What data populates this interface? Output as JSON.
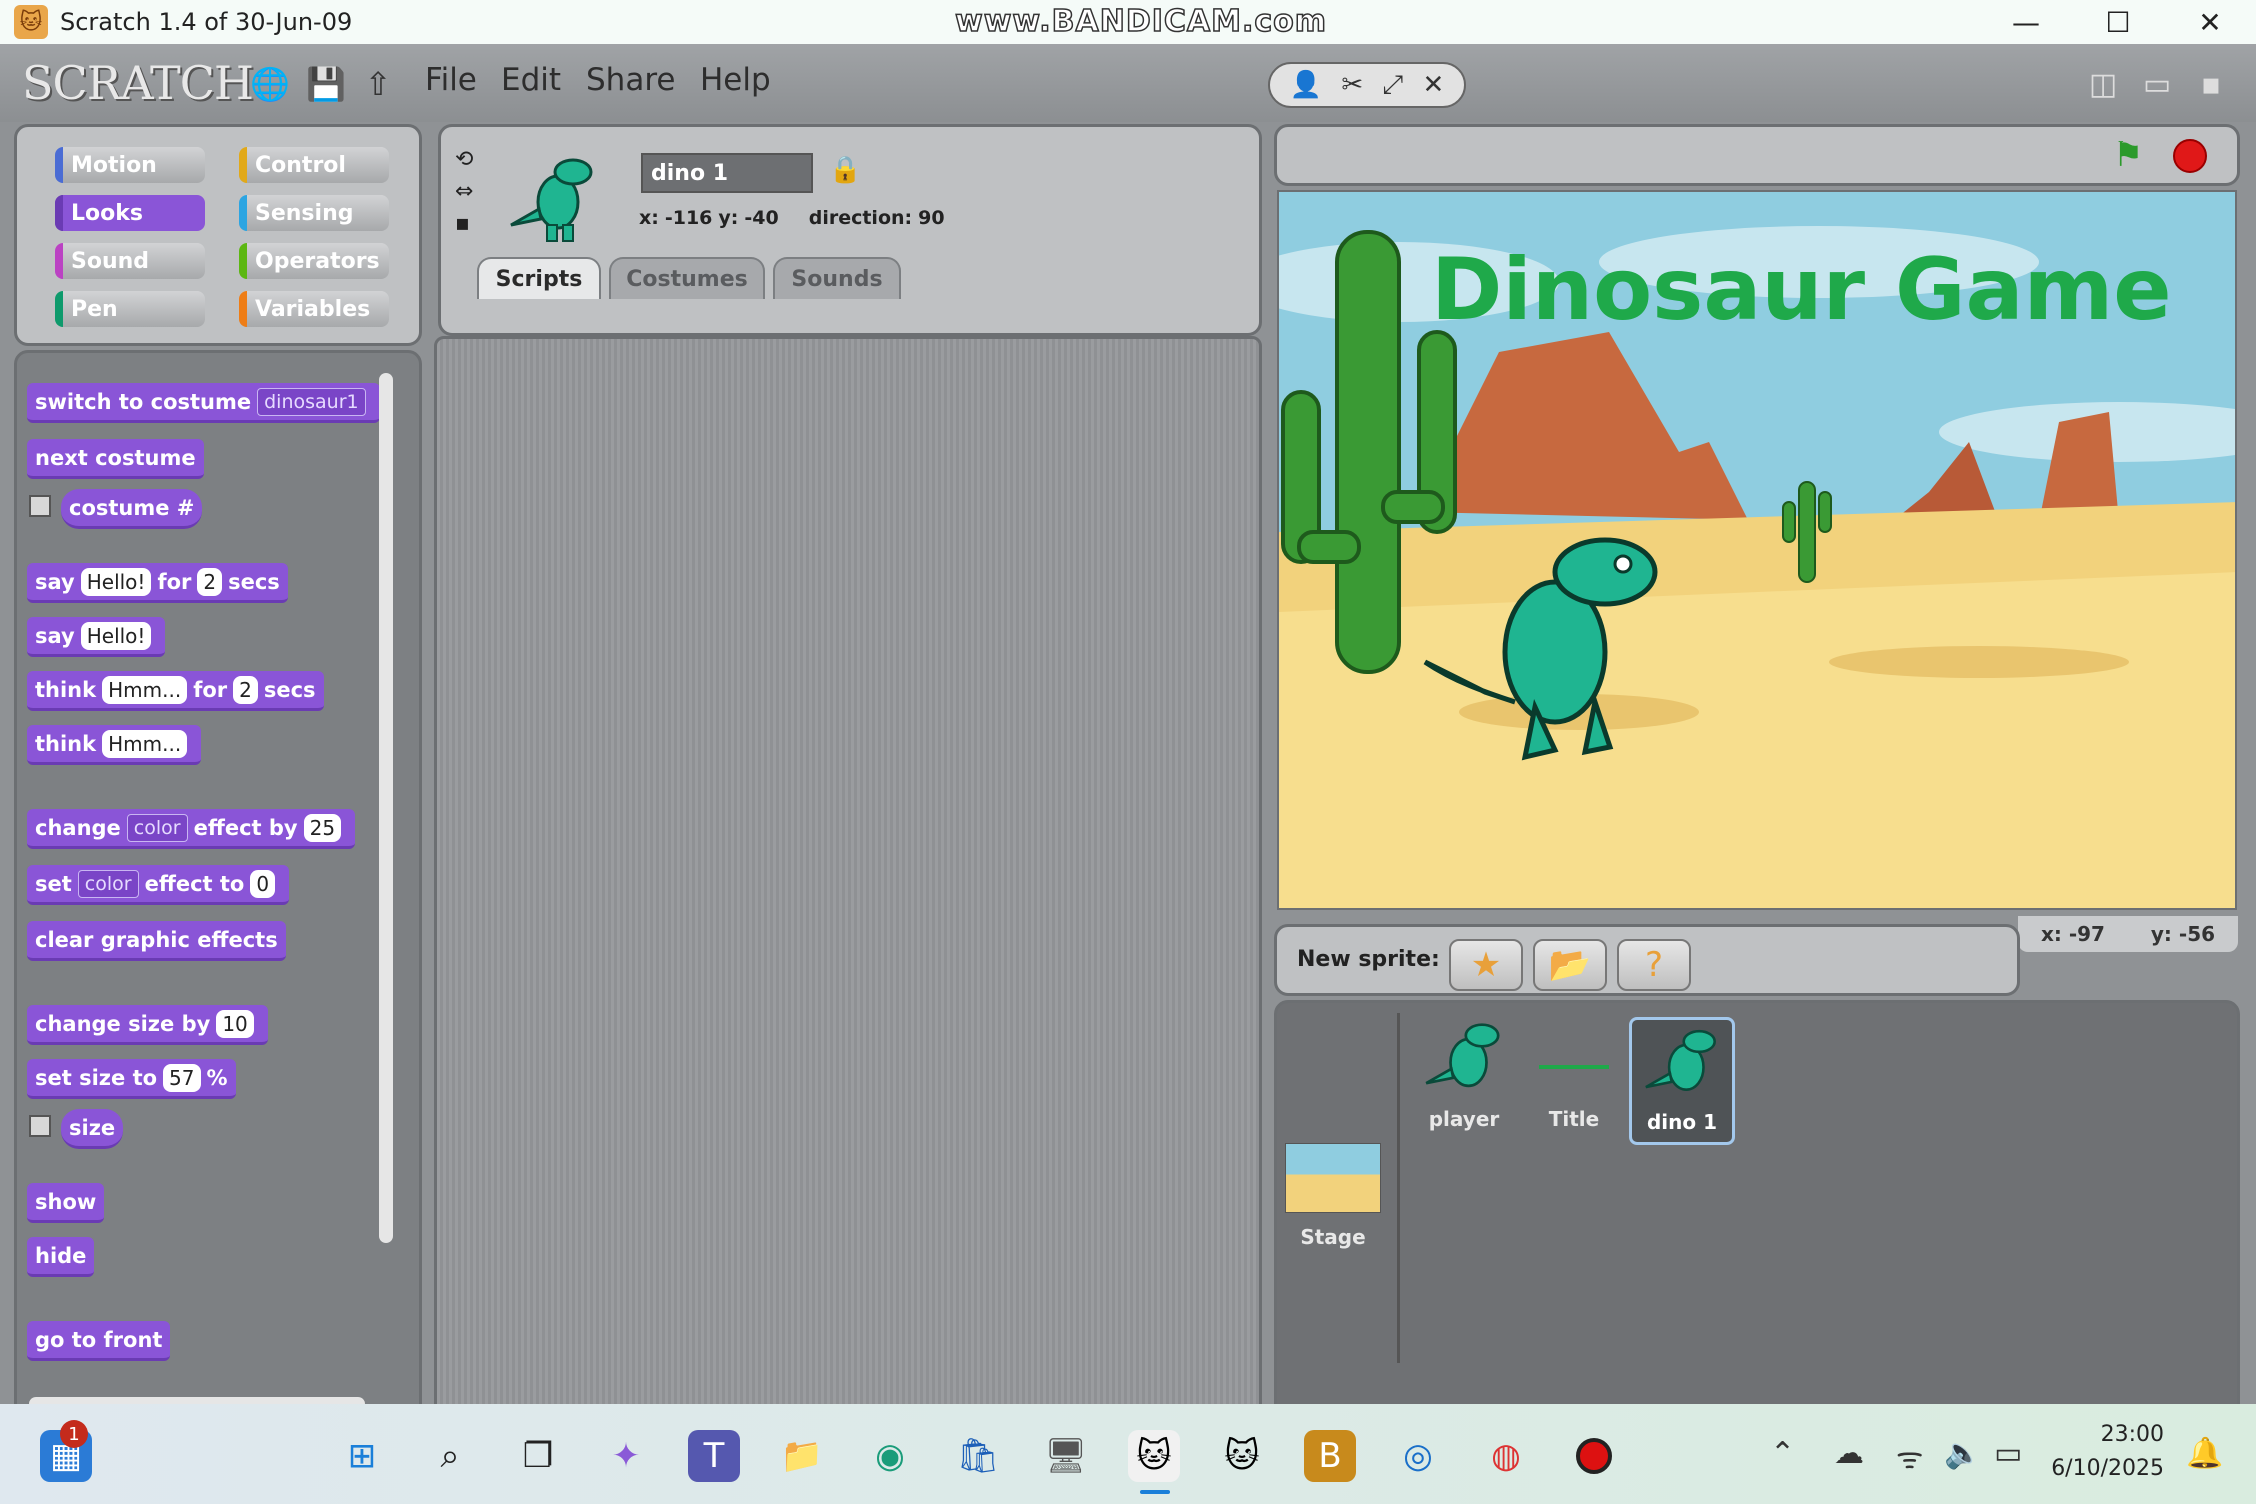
{
  "window": {
    "title": "Scratch 1.4 of 30-Jun-09",
    "watermark": "www.BANDICAM.com",
    "controls": [
      "minimize-icon",
      "maximize-icon",
      "close-icon"
    ]
  },
  "menubar": {
    "logo": "SCRATCH",
    "menus": [
      "File",
      "Edit",
      "Share",
      "Help"
    ],
    "icons": [
      "globe-icon",
      "save-icon",
      "share-upload-icon"
    ],
    "tools": [
      "duplicate-icon",
      "delete-icon",
      "grow-icon",
      "shrink-icon"
    ],
    "view_modes": [
      "small-stage-icon",
      "normal-stage-icon",
      "presentation-icon"
    ]
  },
  "categories": [
    {
      "label": "Motion",
      "color": "#4a6cd4"
    },
    {
      "label": "Control",
      "color": "#e1a91a"
    },
    {
      "label": "Looks",
      "color": "#8a55d7",
      "active": true
    },
    {
      "label": "Sensing",
      "color": "#2ca5e2"
    },
    {
      "label": "Sound",
      "color": "#bb42c3"
    },
    {
      "label": "Operators",
      "color": "#5cb712"
    },
    {
      "label": "Pen",
      "color": "#0e9a6c"
    },
    {
      "label": "Variables",
      "color": "#ee7d16"
    }
  ],
  "blocks": {
    "switch_costume": {
      "label": "switch to costume",
      "value": "dinosaur1"
    },
    "next_costume": "next costume",
    "costume_num": "costume #",
    "say_for": {
      "a": "say",
      "text": "Hello!",
      "b": "for",
      "secs": "2",
      "c": "secs"
    },
    "say": {
      "a": "say",
      "text": "Hello!"
    },
    "think_for": {
      "a": "think",
      "text": "Hmm...",
      "b": "for",
      "secs": "2",
      "c": "secs"
    },
    "think": {
      "a": "think",
      "text": "Hmm..."
    },
    "change_effect": {
      "a": "change",
      "effect": "color",
      "b": "effect by",
      "value": "25"
    },
    "set_effect": {
      "a": "set",
      "effect": "color",
      "b": "effect to",
      "value": "0"
    },
    "clear_effects": "clear graphic effects",
    "change_size": {
      "a": "change size by",
      "value": "10"
    },
    "set_size": {
      "a": "set size to",
      "value": "57",
      "b": "%"
    },
    "size": "size",
    "show": "show",
    "hide": "hide",
    "go_front": "go to front"
  },
  "sprite": {
    "name": "dino 1",
    "x_label": "x:",
    "x": "-116",
    "y_label": "y:",
    "y": "-40",
    "direction_label": "direction:",
    "direction": "90",
    "rotation_icons": [
      "rotate-icon",
      "flip-icon",
      "no-rotate-icon"
    ]
  },
  "tabs": [
    {
      "label": "Scripts",
      "active": true
    },
    {
      "label": "Costumes"
    },
    {
      "label": "Sounds"
    }
  ],
  "stage": {
    "title_text": "Dinosaur Game",
    "mouse_x_label": "x:",
    "mouse_x": "-97",
    "mouse_y_label": "y:",
    "mouse_y": "-56"
  },
  "new_sprite": {
    "label": "New sprite:",
    "buttons": [
      "paint-sprite-icon",
      "choose-sprite-icon",
      "random-sprite-icon"
    ]
  },
  "sprite_list": [
    {
      "name": "player"
    },
    {
      "name": "Title"
    },
    {
      "name": "dino 1",
      "selected": true
    }
  ],
  "stage_thumb": {
    "name": "Stage"
  },
  "taskbar": {
    "notification_count": "1",
    "time": "23:00",
    "date": "6/10/2025"
  }
}
